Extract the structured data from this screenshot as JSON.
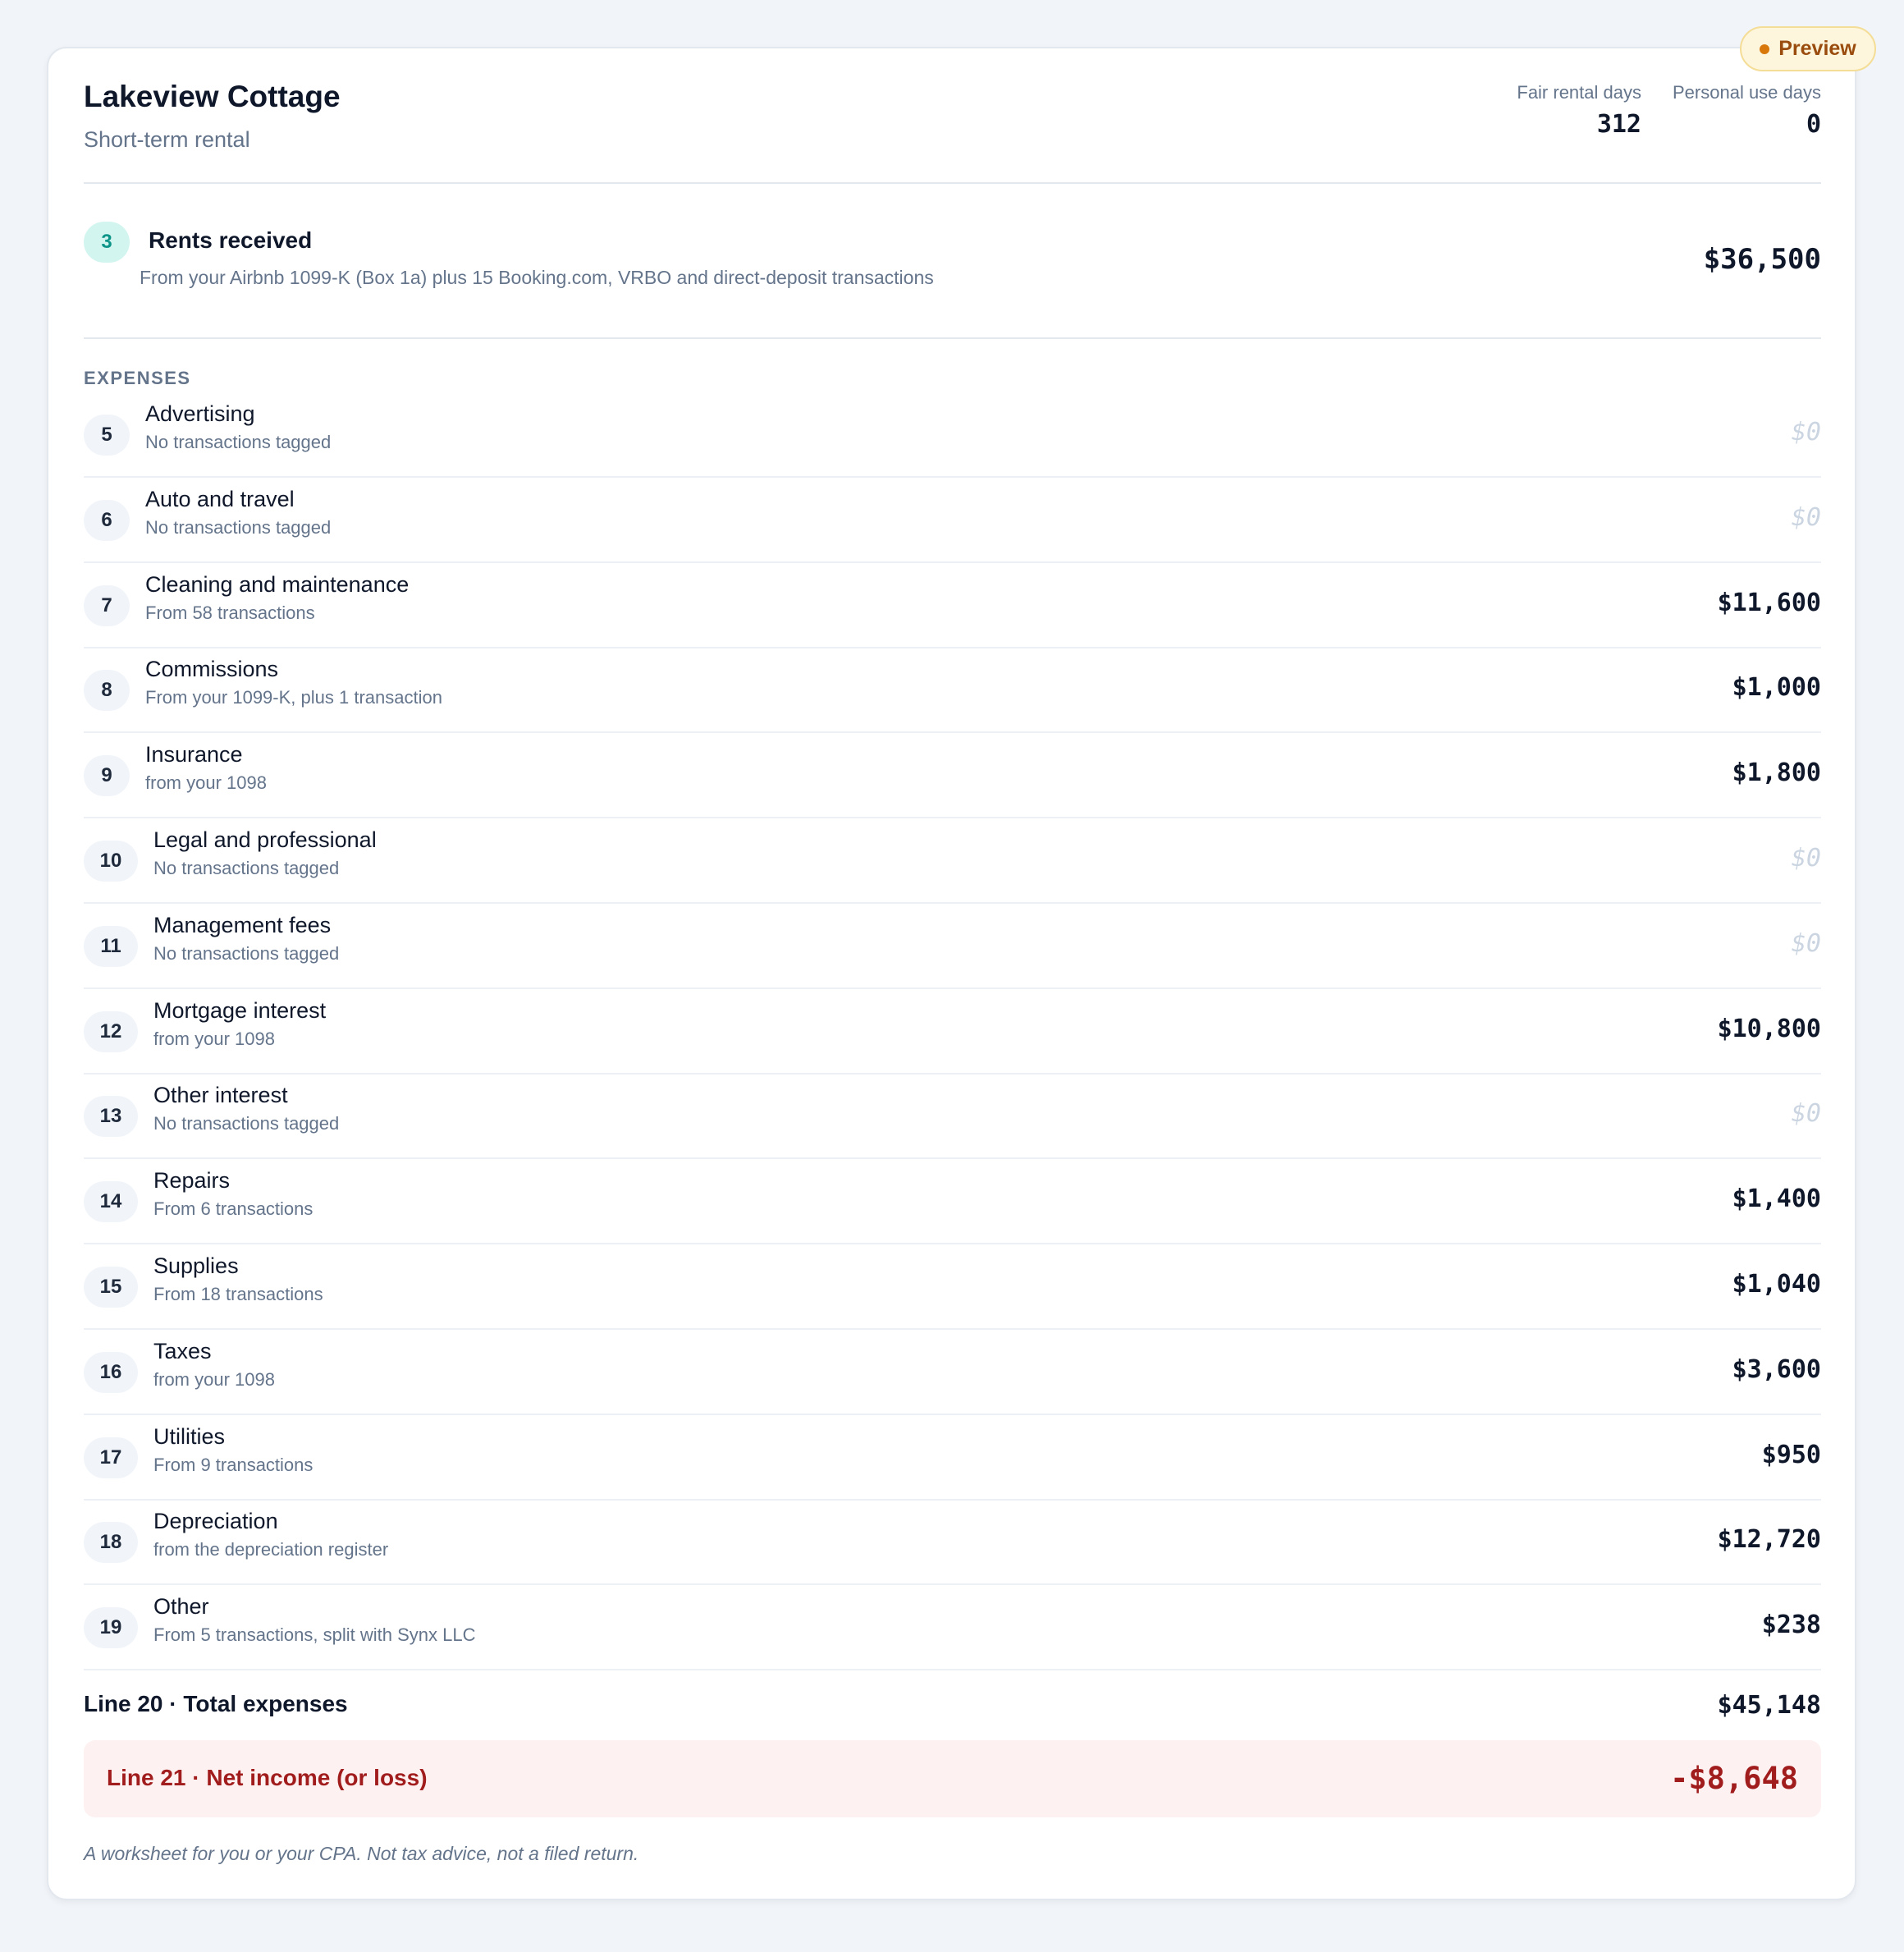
{
  "badge": {
    "label": "Preview",
    "color": "#d9780a"
  },
  "property": {
    "name": "Lakeview Cottage",
    "type": "Short-term rental"
  },
  "stats": {
    "fair_rental_days": {
      "label": "Fair rental days",
      "value": "312"
    },
    "personal_use_days": {
      "label": "Personal use days",
      "value": "0"
    }
  },
  "rents": {
    "line": "3",
    "label": "Rents received",
    "description": "From your Airbnb 1099-K (Box 1a) plus 15 Booking.com, VRBO and direct-deposit transactions",
    "amount": "$36,500"
  },
  "expenses": {
    "section_label": "EXPENSES",
    "rows": [
      {
        "line": "5",
        "label": "Advertising",
        "source": "No transactions tagged",
        "amount": "$0",
        "zero": true
      },
      {
        "line": "6",
        "label": "Auto and travel",
        "source": "No transactions tagged",
        "amount": "$0",
        "zero": true
      },
      {
        "line": "7",
        "label": "Cleaning and maintenance",
        "source": "From 58 transactions",
        "amount": "$11,600",
        "zero": false
      },
      {
        "line": "8",
        "label": "Commissions",
        "source": "From your 1099-K, plus 1 transaction",
        "amount": "$1,000",
        "zero": false
      },
      {
        "line": "9",
        "label": "Insurance",
        "source": "from your 1098",
        "amount": "$1,800",
        "zero": false
      },
      {
        "line": "10",
        "label": "Legal and professional",
        "source": "No transactions tagged",
        "amount": "$0",
        "zero": true
      },
      {
        "line": "11",
        "label": "Management fees",
        "source": "No transactions tagged",
        "amount": "$0",
        "zero": true
      },
      {
        "line": "12",
        "label": "Mortgage interest",
        "source": "from your 1098",
        "amount": "$10,800",
        "zero": false
      },
      {
        "line": "13",
        "label": "Other interest",
        "source": "No transactions tagged",
        "amount": "$0",
        "zero": true
      },
      {
        "line": "14",
        "label": "Repairs",
        "source": "From 6 transactions",
        "amount": "$1,400",
        "zero": false
      },
      {
        "line": "15",
        "label": "Supplies",
        "source": "From 18 transactions",
        "amount": "$1,040",
        "zero": false
      },
      {
        "line": "16",
        "label": "Taxes",
        "source": "from your 1098",
        "amount": "$3,600",
        "zero": false
      },
      {
        "line": "17",
        "label": "Utilities",
        "source": "From 9 transactions",
        "amount": "$950",
        "zero": false
      },
      {
        "line": "18",
        "label": "Depreciation",
        "source": "from the depreciation register",
        "amount": "$12,720",
        "zero": false
      },
      {
        "line": "19",
        "label": "Other",
        "source": "From 5 transactions, split with Synx LLC",
        "amount": "$238",
        "zero": false
      }
    ]
  },
  "total_expenses": {
    "label": "Line 20 · Total expenses",
    "amount": "$45,148"
  },
  "net_income": {
    "label": "Line 21 · Net income (or loss)",
    "amount": "-$8,648",
    "color": "#a11d1d"
  },
  "footnote": "A worksheet for you or your CPA. Not tax advice, not a filed return."
}
